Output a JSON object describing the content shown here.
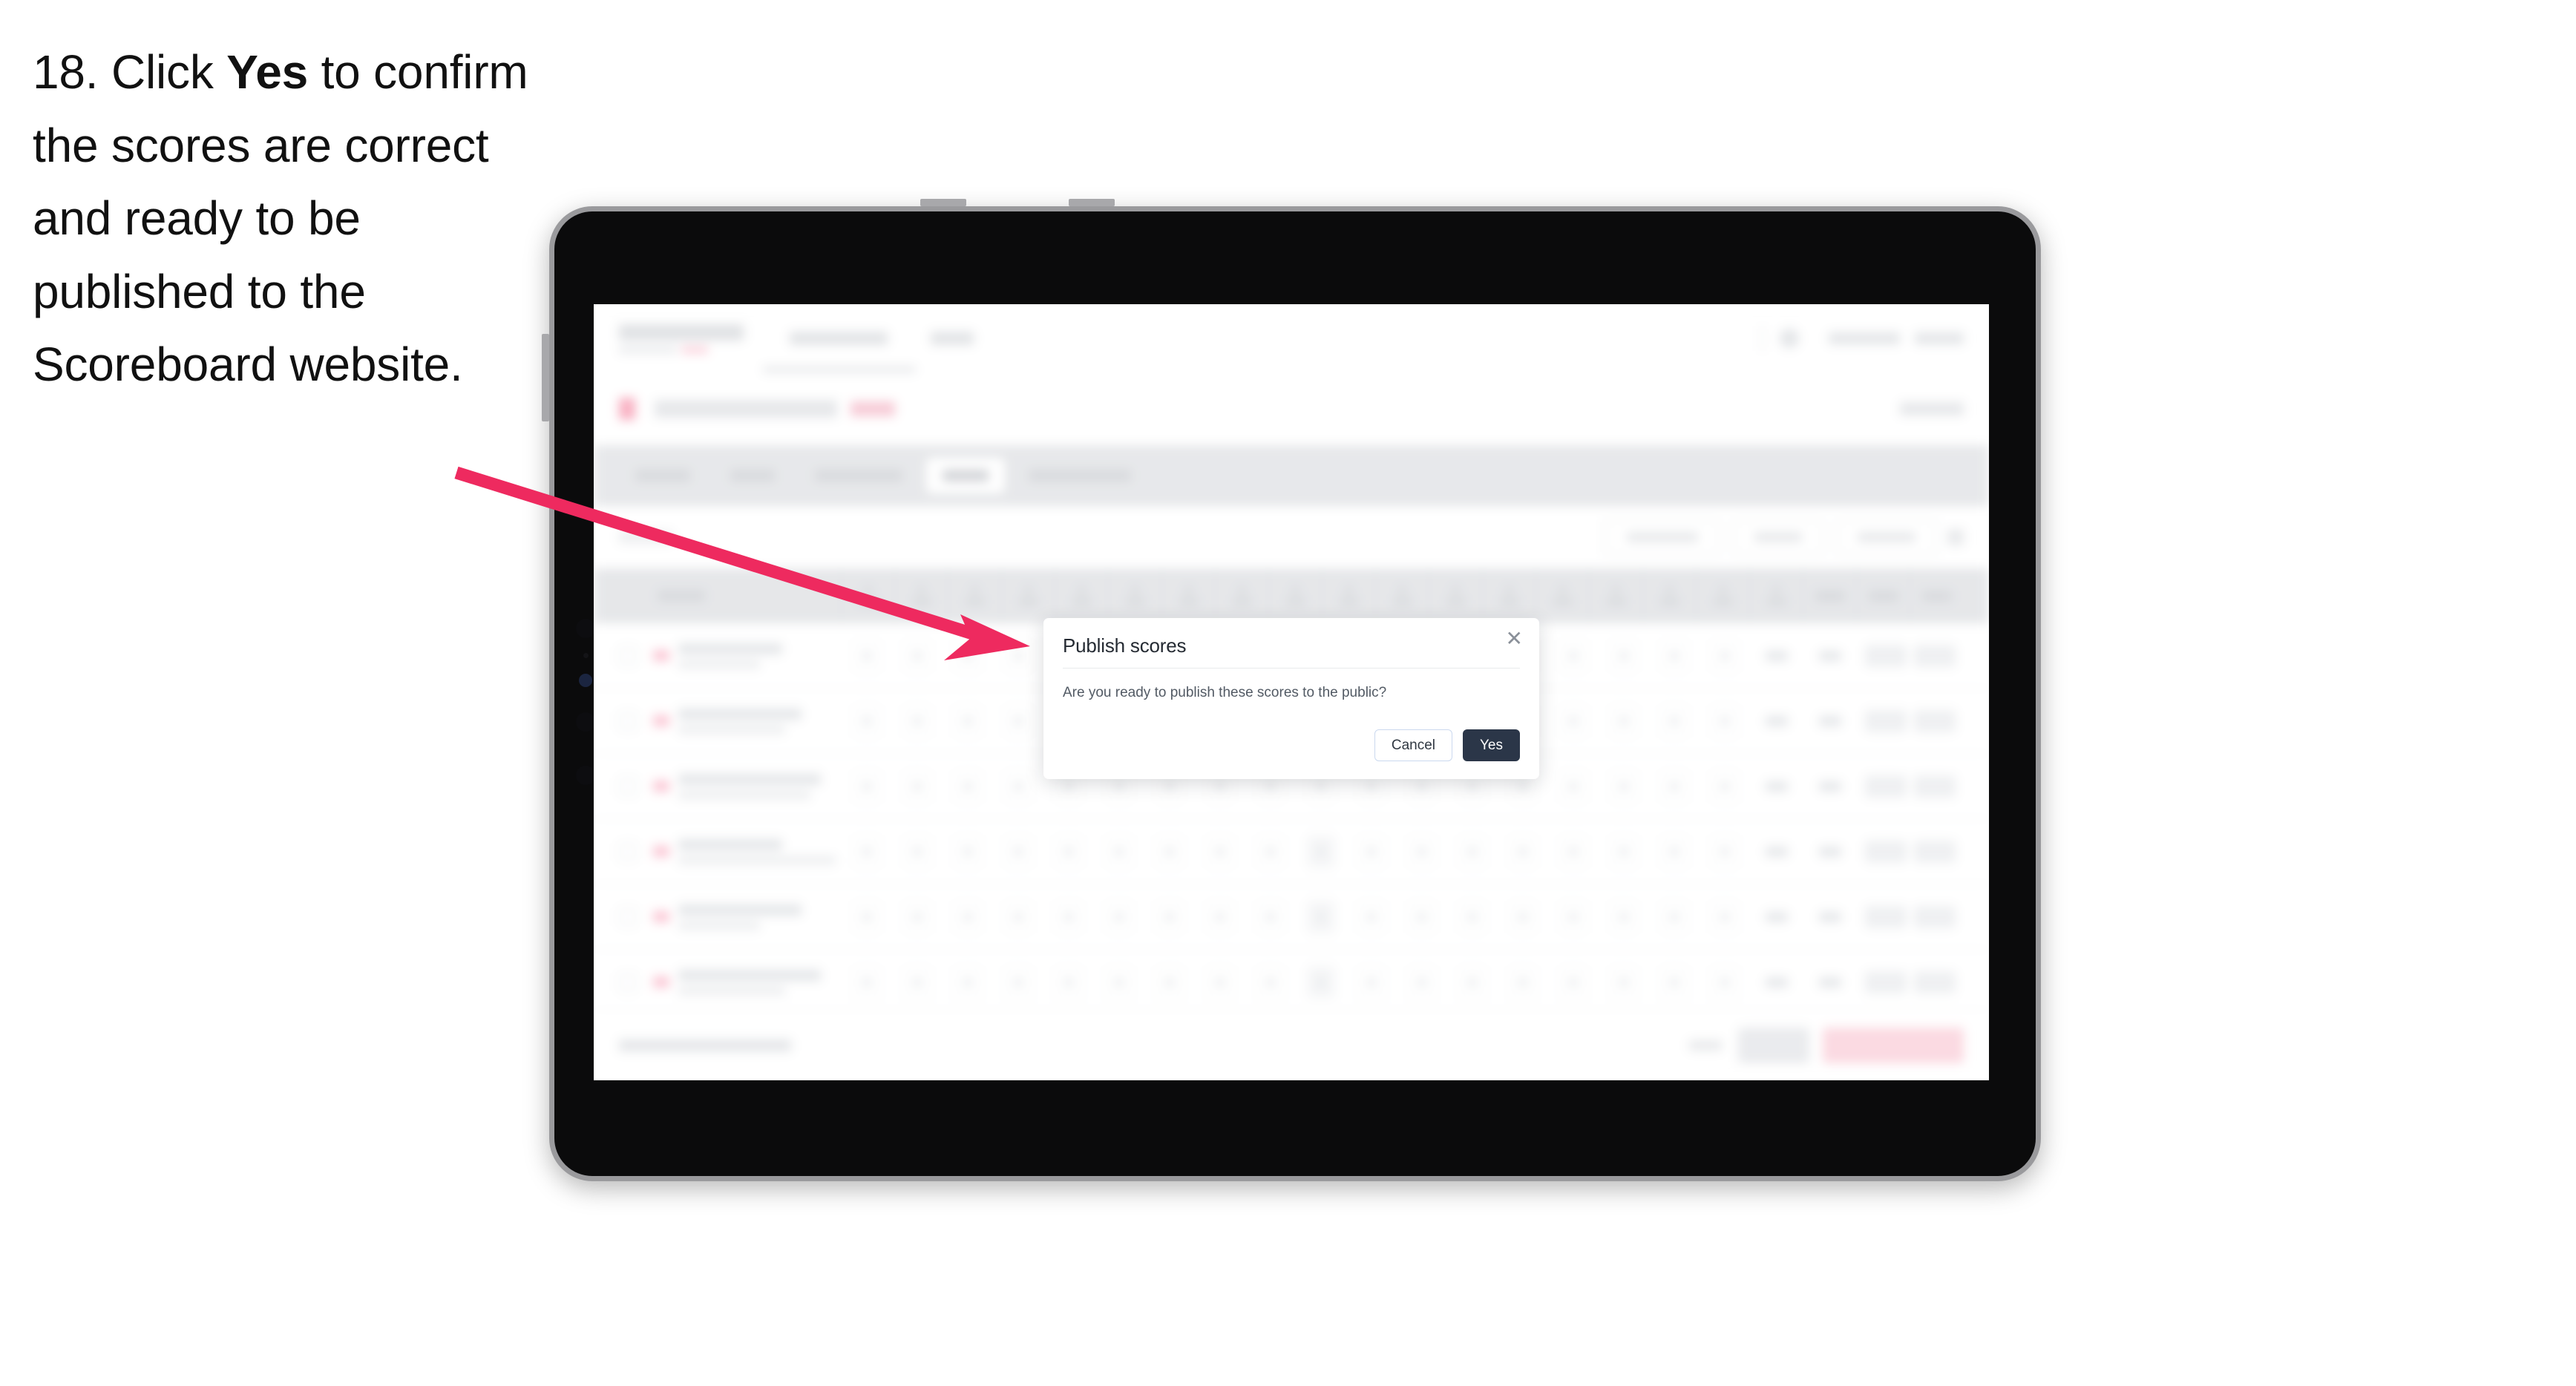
{
  "instruction": {
    "number": "18.",
    "lead": "Click",
    "emphasis": "Yes",
    "rest": "to confirm the scores are correct and ready to be published to the Scoreboard website.",
    "full_text": "18. Click Yes to confirm the scores are correct and ready to be published to the Scoreboard website."
  },
  "annotation": {
    "arrow_color": "#ee2a5f",
    "points_to": "publish-scores-modal"
  },
  "device": {
    "type": "tablet",
    "frame_color": "#9a9a9d",
    "bezel_color": "#0b0b0c"
  },
  "modal": {
    "title": "Publish scores",
    "close_icon": "close-icon",
    "close_glyph": "✕",
    "body": "Are you ready to publish these scores to the public?",
    "cancel_label": "Cancel",
    "confirm_label": "Yes",
    "confirm_color": "#2b3648",
    "cancel_border_color": "#cbd9ef"
  },
  "app": {
    "blurred": true,
    "note": "background application content is blurred and illegible",
    "topnav": {
      "logo": "scoreboard-logo",
      "links": [
        "",
        ""
      ],
      "account_links": [
        "",
        ""
      ]
    },
    "event": {
      "flag": "event-flag-icon",
      "name": "",
      "year": "",
      "right_action": ""
    },
    "tabs": [
      {
        "label": "",
        "active": false
      },
      {
        "label": "",
        "active": false
      },
      {
        "label": "",
        "active": false
      },
      {
        "label": "",
        "active": true
      },
      {
        "label": "",
        "active": false
      }
    ],
    "filters": {
      "search_placeholder": "",
      "pills": [
        "",
        "",
        ""
      ],
      "icon": "filter-icon"
    },
    "table": {
      "header": {
        "player_label": "",
        "hole_count": 18,
        "extra_columns": [
          "",
          "",
          ""
        ]
      },
      "rows": [
        {
          "name": "",
          "club": "",
          "emphasis_cells": []
        },
        {
          "name": "",
          "club": "",
          "emphasis_cells": []
        },
        {
          "name": "",
          "club": "",
          "emphasis_cells": []
        },
        {
          "name": "",
          "club": "",
          "emphasis_cells": [
            9
          ]
        },
        {
          "name": "",
          "club": "",
          "emphasis_cells": [
            9
          ]
        },
        {
          "name": "",
          "club": "",
          "emphasis_cells": [
            9
          ]
        },
        {
          "name": "",
          "club": "",
          "emphasis_cells": [
            9
          ]
        }
      ]
    },
    "bottombar": {
      "status": "",
      "link": "",
      "secondary_button": "",
      "primary_button": ""
    }
  }
}
